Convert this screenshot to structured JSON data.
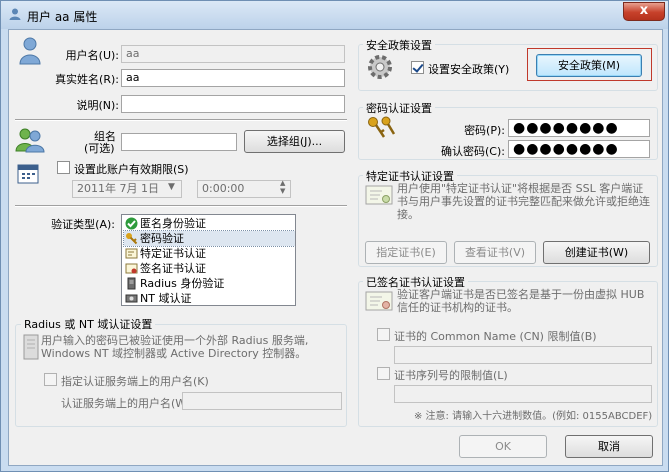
{
  "window": {
    "title": "用户 aa 属性",
    "close_glyph": "x"
  },
  "user": {
    "username_label": "用户名(U):",
    "username_value": "aa",
    "realname_label": "真实姓名(R):",
    "realname_value": "aa",
    "description_label": "说明(N):",
    "description_value": ""
  },
  "group": {
    "label_line1": "组名",
    "label_line2": "(可选)",
    "value": "",
    "select_button": "选择组(J)..."
  },
  "expiry": {
    "checkbox_label": "设置此账户有效期限(S)",
    "date_value": "2011年  7月  1日",
    "time_value": "0:00:00"
  },
  "auth": {
    "type_label": "验证类型(A):",
    "items": [
      {
        "label": "匿名身份验证",
        "icon": "green-check-icon"
      },
      {
        "label": "密码验证",
        "icon": "key-icon",
        "selected": true
      },
      {
        "label": "特定证书认证",
        "icon": "certificate-icon"
      },
      {
        "label": "签名证书认证",
        "icon": "signed-certificate-icon"
      },
      {
        "label": "Radius 身份验证",
        "icon": "server-icon"
      },
      {
        "label": "NT 域认证",
        "icon": "domain-icon"
      }
    ]
  },
  "radius": {
    "group_title": "Radius 或 NT 域认证设置",
    "description": "用户输入的密码已被验证使用一个外部 Radius 服务端, Windows NT 域控制器或 Active Directory 控制器。",
    "checkbox_label": "指定认证服务端上的用户名(K)",
    "username_label": "认证服务端上的用户名(W):",
    "username_value": ""
  },
  "security_policy": {
    "group_title": "安全政策设置",
    "checkbox_label": "设置安全政策(Y)",
    "checked": true,
    "button": "安全政策(M)"
  },
  "password": {
    "group_title": "密码认证设置",
    "password_label": "密码(P):",
    "password_value": "●●●●●●●●",
    "confirm_label": "确认密码(C):",
    "confirm_value": "●●●●●●●●"
  },
  "cert": {
    "group_title": "特定证书认证设置",
    "description": "用户使用\"特定证书认证\"将根据是否 SSL 客户端证书与用户事先设置的证书完整匹配来做允许或拒绝连接。",
    "buttons": {
      "specify": "指定证书(E)",
      "view": "查看证书(V)",
      "create": "创建证书(W)"
    }
  },
  "signed_cert": {
    "group_title": "已签名证书认证设置",
    "description": "验证客户端证书是否已签名是基于一份由虚拟 HUB 信任的证书机构的证书。",
    "cn_checkbox": "证书的 Common Name (CN) 限制值(B)",
    "serial_checkbox": "证书序列号的限制值(L)",
    "note": "※ 注意: 请输入十六进制数值。(例如: 0155ABCDEF)"
  },
  "footer": {
    "ok": "OK",
    "cancel": "取消"
  },
  "colors": {
    "title_bar": "#bcd2ea",
    "dialog_bg": "#f0f0f0",
    "focus_border": "#3c7fb1",
    "highlight_red": "#c0392b"
  }
}
